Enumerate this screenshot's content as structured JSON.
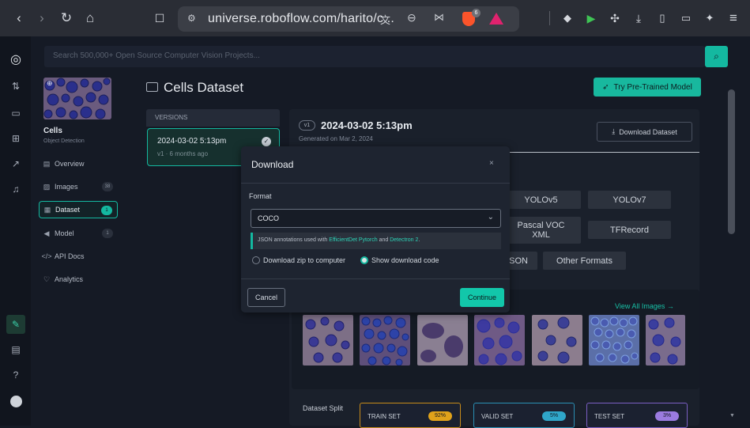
{
  "browser": {
    "url": "universe.roboflow.com/harito/c...",
    "brave_count": "6"
  },
  "search": {
    "placeholder": "Search 500,000+ Open Source Computer Vision Projects..."
  },
  "project": {
    "name": "Cells",
    "type": "Object Detection"
  },
  "nav": [
    {
      "label": "Overview",
      "count": ""
    },
    {
      "label": "Images",
      "count": "38"
    },
    {
      "label": "Dataset",
      "count": "1"
    },
    {
      "label": "Model",
      "count": "1"
    },
    {
      "label": "API Docs",
      "count": ""
    },
    {
      "label": "Analytics",
      "count": ""
    }
  ],
  "header": {
    "title": "Cells Dataset",
    "try_model": "Try Pre-Trained Model"
  },
  "versions": {
    "label": "VERSIONS",
    "item_title": "2024-03-02 5:13pm",
    "item_meta": "v1 · 6 months ago"
  },
  "version_panel": {
    "badge": "v1",
    "title": "2024-03-02 5:13pm",
    "generated": "Generated on Mar 2, 2024",
    "download_btn": "Download Dataset"
  },
  "formats": [
    "YOLOv5",
    "YOLOv7",
    "Pascal VOC XML",
    "TFRecord",
    "JSON",
    "Other Formats"
  ],
  "images": {
    "view_all": "View All Images →"
  },
  "split": {
    "label": "Dataset Split",
    "train": "TRAIN SET",
    "train_pct": "92%",
    "valid": "VALID SET",
    "valid_pct": "5%",
    "test": "TEST SET",
    "test_pct": "3%"
  },
  "modal": {
    "title": "Download",
    "close": "×",
    "format_label": "Format",
    "format_value": "COCO",
    "info_prefix": "JSON annotations used with ",
    "info_link1": "EfficientDet Pytorch",
    "info_mid": " and ",
    "info_link2": "Detectron 2",
    "info_suffix": ".",
    "option_zip": "Download zip to computer",
    "option_code": "Show download code",
    "cancel": "Cancel",
    "continue": "Continue"
  },
  "colors": {
    "accent": "#14b8a0",
    "valid_pill": "#2fa6c9",
    "train_pill": "#e0a21a",
    "test_pill": "#9b7be0"
  }
}
